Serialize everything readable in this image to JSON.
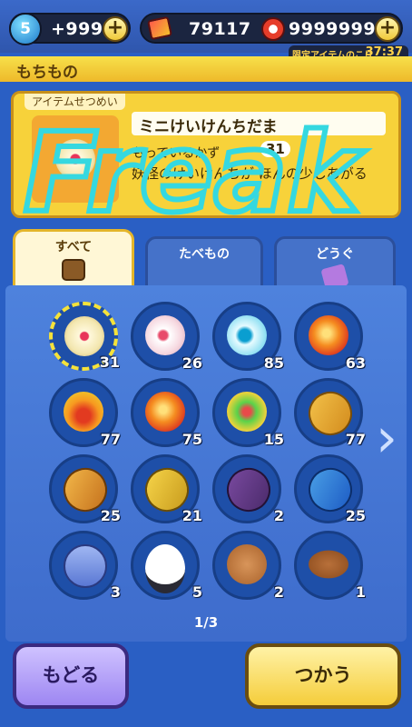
{
  "topbar": {
    "orb_level": "5",
    "orb_count": "+999",
    "ticket_count": "79117",
    "coin_count": "9999999",
    "limited_label": "限定アイテムのこり",
    "limited_time": "37:37"
  },
  "header": {
    "title": "もちもの"
  },
  "description": {
    "section_label": "アイテムせつめい",
    "item_name": "ミニけいけんちだま",
    "owned_label": "もっているかず",
    "owned_count": "31",
    "text": "妖怪のけいけんちが ほんの少しあがる",
    "overlay_text": "Freak"
  },
  "tabs": [
    {
      "label": "すべて",
      "icon": "bag-icon",
      "active": true
    },
    {
      "label": "たべもの",
      "icon": "onigiri-icon",
      "active": false
    },
    {
      "label": "どうぐ",
      "icon": "scroll-icon",
      "active": false
    }
  ],
  "items": [
    {
      "icon": "mini-exp-orb-icon",
      "count": "31",
      "selected": true
    },
    {
      "icon": "pink-orb-icon",
      "count": "26"
    },
    {
      "icon": "teal-orb-icon",
      "count": "85"
    },
    {
      "icon": "red-orb-icon",
      "count": "63"
    },
    {
      "icon": "flame-orb-icon",
      "count": "77"
    },
    {
      "icon": "crystal-orb-icon",
      "count": "75"
    },
    {
      "icon": "golden-orb-icon",
      "count": "15"
    },
    {
      "icon": "book-icon",
      "count": "77"
    },
    {
      "icon": "book-icon",
      "count": "25"
    },
    {
      "icon": "book-stack-icon",
      "count": "21"
    },
    {
      "icon": "purple-book-icon",
      "count": "2"
    },
    {
      "icon": "blue-book-icon",
      "count": "25"
    },
    {
      "icon": "glove-icon",
      "count": "3"
    },
    {
      "icon": "rice-ball-icon",
      "count": "5"
    },
    {
      "icon": "bread-icon",
      "count": "2"
    },
    {
      "icon": "pie-icon",
      "count": "1"
    }
  ],
  "pagination": {
    "text": "1/3"
  },
  "buttons": {
    "back": "もどる",
    "use": "つかう"
  }
}
